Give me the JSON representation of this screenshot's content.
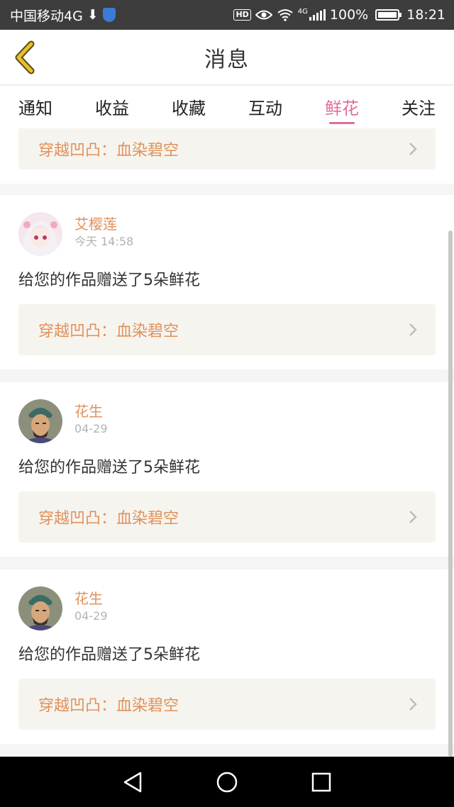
{
  "status_bar": {
    "carrier": "中国移动4G",
    "download_glyph": "⬇",
    "hd": "HD",
    "net": "4G",
    "battery": "100%",
    "battery_level": 1.0,
    "time": "18:21"
  },
  "header": {
    "title": "消息",
    "back_icon": "chevron-left-icon"
  },
  "tabs": [
    {
      "label": "通知"
    },
    {
      "label": "收益"
    },
    {
      "label": "收藏"
    },
    {
      "label": "互动"
    },
    {
      "label": "鲜花"
    },
    {
      "label": "关注"
    }
  ],
  "active_tab": "鲜花",
  "colors": {
    "accent": "#e06c9f",
    "name": "#e0915a",
    "link_bg": "#f6f4ef",
    "back_icon": "#e6c12b"
  },
  "top_partial_card": {
    "book_title": "穿越凹凸：血染碧空"
  },
  "messages": [
    {
      "username": "艾樱莲",
      "time": "今天 14:58",
      "text": "给您的作品赠送了5朵鲜花",
      "book_title": "穿越凹凸：血染碧空",
      "avatar": "anime-girl-avatar"
    },
    {
      "username": "花生",
      "time": "04-29",
      "text": "给您的作品赠送了5朵鲜花",
      "book_title": "穿越凹凸：血染碧空",
      "avatar": "warrior-avatar"
    },
    {
      "username": "花生",
      "time": "04-29",
      "text": "给您的作品赠送了5朵鲜花",
      "book_title": "穿越凹凸：血染碧空",
      "avatar": "warrior-avatar"
    }
  ],
  "nav": [
    "back-triangle-icon",
    "home-circle-icon",
    "recents-square-icon"
  ]
}
